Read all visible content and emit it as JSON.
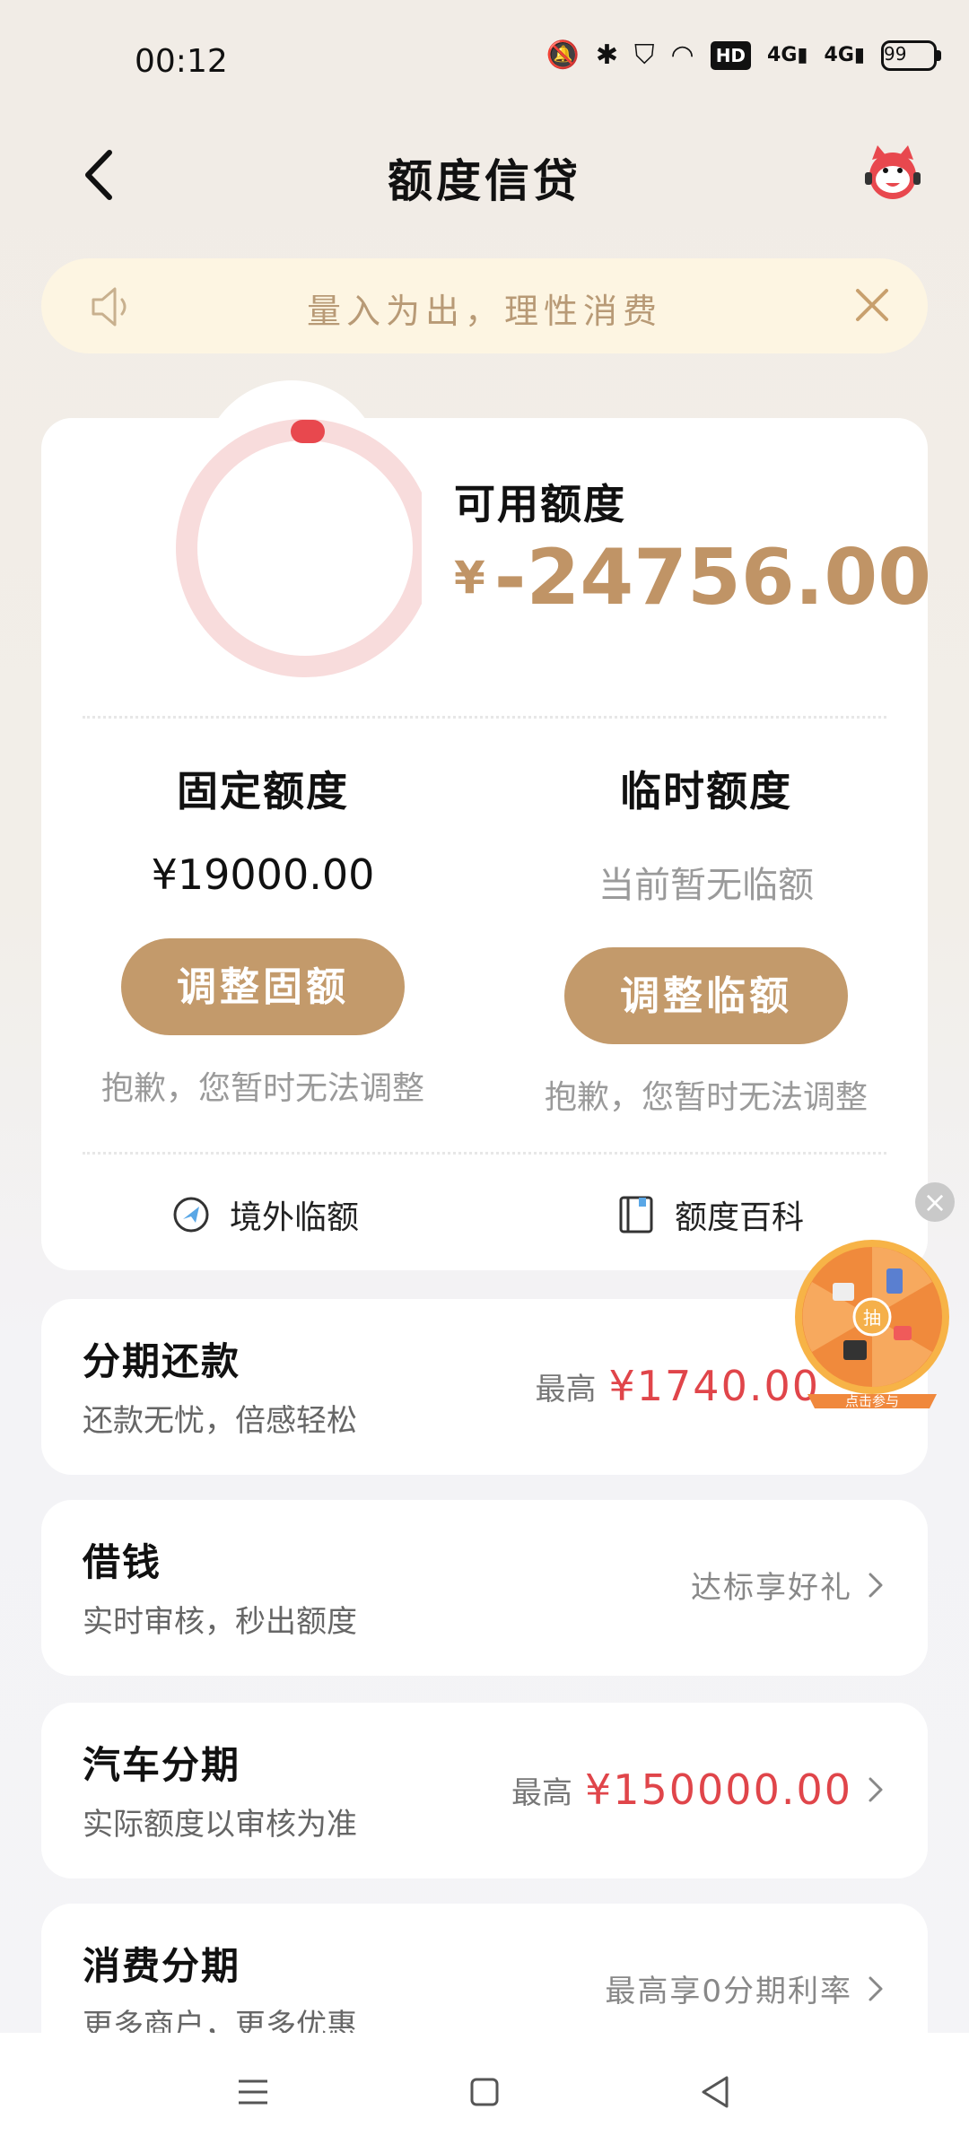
{
  "status_bar": {
    "time": "00:12",
    "network_1": "4G",
    "network_2": "4G",
    "hd_label": "HD",
    "battery": "99"
  },
  "header": {
    "title": "额度信贷"
  },
  "notice": {
    "text": "量入为出，理性消费"
  },
  "credit": {
    "available_label": "可用额度",
    "currency": "¥",
    "available_amount": "-24756.00",
    "ring_progress_percent": 0,
    "fixed": {
      "title": "固定额度",
      "value": "¥19000.00",
      "button": "调整固额",
      "note": "抱歉，您暂时无法调整"
    },
    "temp": {
      "title": "临时额度",
      "value": "当前暂无临额",
      "button": "调整临额",
      "note": "抱歉，您暂时无法调整"
    },
    "links": {
      "overseas": "境外临额",
      "wiki": "额度百科"
    }
  },
  "products": [
    {
      "title": "分期还款",
      "subtitle": "还款无忧，倍感轻松",
      "prefix": "最高",
      "amount": "¥1740.00"
    },
    {
      "title": "借钱",
      "subtitle": "实时审核，秒出额度",
      "text": "达标享好礼"
    },
    {
      "title": "汽车分期",
      "subtitle": "实际额度以审核为准",
      "prefix": "最高",
      "amount": "¥150000.00"
    },
    {
      "title": "消费分期",
      "subtitle": "更多商户，更多优惠",
      "text": "最高享0分期利率"
    }
  ],
  "lottery": {
    "center_label": "抽",
    "banner": "点击参与"
  },
  "colors": {
    "accent_gold": "#c39a6b",
    "amount_red": "#e0454a",
    "ring_pink": "#f8dcdc",
    "ring_red": "#e8484e"
  }
}
